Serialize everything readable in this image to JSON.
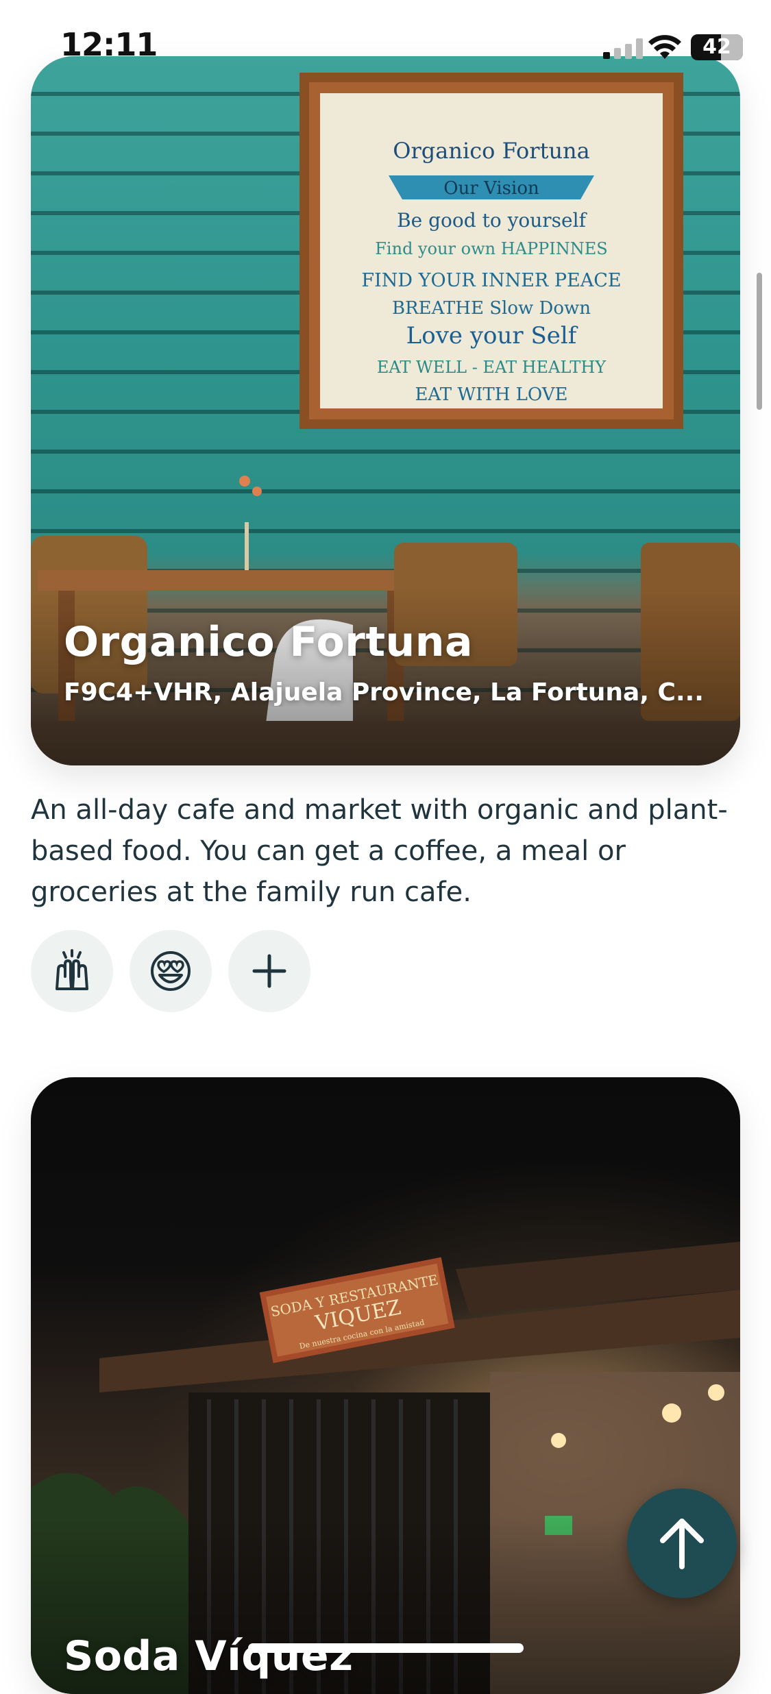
{
  "status_bar": {
    "time": "12:11",
    "battery": "42",
    "battery_level": 0.42
  },
  "places": [
    {
      "name": "Organico Fortuna",
      "address": "F9C4+VHR, Alajuela Province, La Fortuna, C...",
      "description": "An all-day cafe and market with organic and plant-based food. You can get a coffee, a meal or groceries at the family run cafe.",
      "sign_text": {
        "title": "Organico Fortuna",
        "banner": "Our Vision",
        "lines": [
          "Be good to yourself",
          "Find your own HAPPINNES",
          "FIND YOUR INNER PEACE",
          "BREATHE Slow Down",
          "Love your Self",
          "EAT WELL - EAT HEALTHY",
          "EAT WITH LOVE"
        ]
      },
      "reactions": [
        {
          "icon": "raised-hands-icon"
        },
        {
          "icon": "heart-eyes-icon"
        },
        {
          "icon": "plus-icon"
        }
      ]
    },
    {
      "name": "Soda Víquez",
      "sign_text": {
        "line1": "SODA Y RESTAURANTE",
        "line2": "VIQUEZ",
        "line3": "De nuestra cocina con la amistad"
      }
    }
  ],
  "colors": {
    "accent": "#1f4c52",
    "text": "#1f343c",
    "reaction_bg": "#eef2f1",
    "wall_teal": "#3ea39b"
  }
}
